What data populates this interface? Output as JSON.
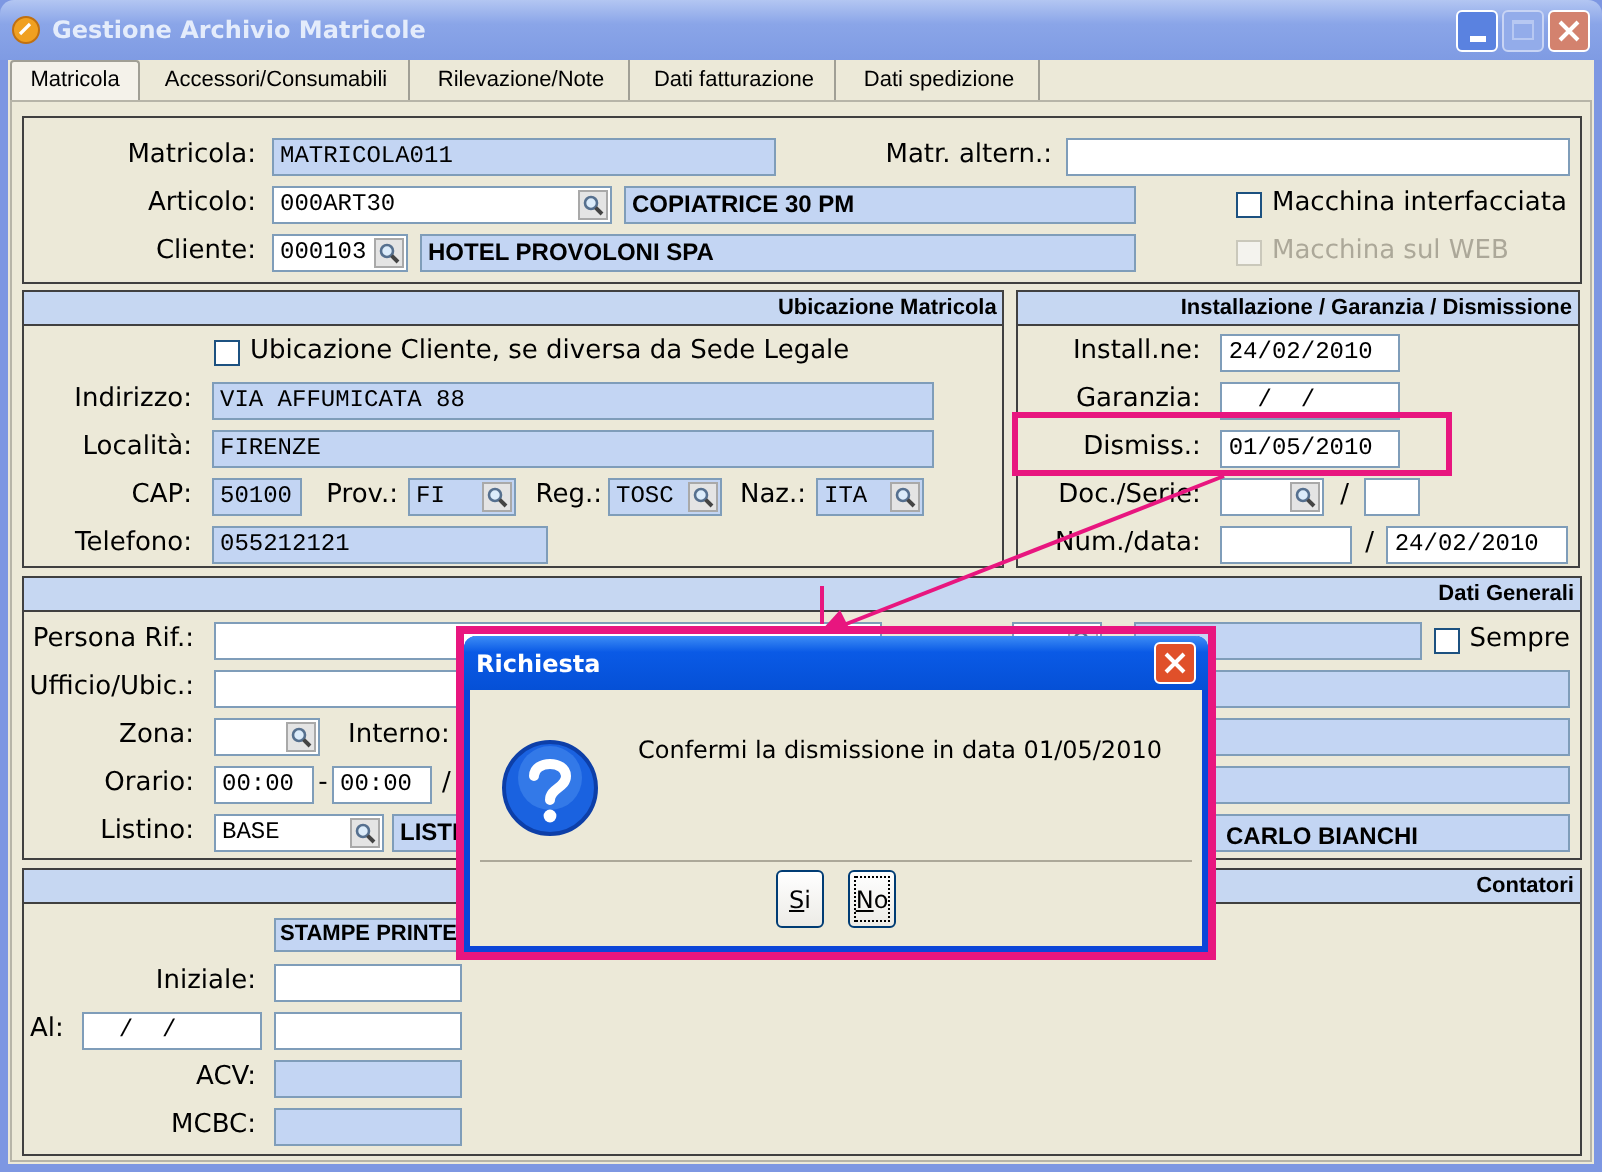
{
  "window": {
    "title": "Gestione Archivio Matricole"
  },
  "tabs": [
    {
      "label": "Matricola",
      "selected": true
    },
    {
      "label": "Accessori/Consumabili",
      "selected": false
    },
    {
      "label": "Rilevazione/Note",
      "selected": false
    },
    {
      "label": "Dati fatturazione",
      "selected": false
    },
    {
      "label": "Dati spedizione",
      "selected": false
    }
  ],
  "matricola": {
    "label": "Matricola:",
    "value": "MATRICOLA011"
  },
  "matr_altern": {
    "label": "Matr. altern.:"
  },
  "articolo": {
    "label": "Articolo:",
    "code": "000ART30",
    "description": "COPIATRICE 30 PM"
  },
  "cliente": {
    "label": "Cliente:",
    "code": "000103",
    "description": "HOTEL PROVOLONI SPA"
  },
  "options": [
    {
      "label": "Macchina interfacciata",
      "checked": false,
      "disabled": false
    },
    {
      "label": "Macchina sul WEB",
      "checked": false,
      "disabled": true
    }
  ],
  "ubicazione": {
    "title": "Ubicazione Matricola",
    "checkbox": {
      "label": "Ubicazione Cliente, se diversa da Sede Legale",
      "checked": false
    },
    "indirizzo": {
      "label": "Indirizzo:",
      "value": "VIA AFFUMICATA 88"
    },
    "localita": {
      "label": "Località:",
      "value": "FIRENZE"
    },
    "cap": {
      "label": "CAP:",
      "value": "50100"
    },
    "prov": {
      "label": "Prov.:",
      "value": "FI"
    },
    "reg": {
      "label": "Reg.:",
      "value": "TOSC"
    },
    "naz": {
      "label": "Naz.:",
      "value": "ITA"
    },
    "telefono": {
      "label": "Telefono:",
      "value": "055212121"
    }
  },
  "installazione": {
    "title": "Installazione / Garanzia / Dismissione",
    "install": {
      "label": "Install.ne:",
      "value": "24/02/2010"
    },
    "garanzia": {
      "label": "Garanzia:",
      "value": "  /  /"
    },
    "dismiss": {
      "label": "Dismiss.:",
      "value": "01/05/2010"
    },
    "doc_serie": {
      "label": "Doc./Serie:",
      "separator": "/"
    },
    "num_data": {
      "label": "Num./data:",
      "separator": "/",
      "date": "24/02/2010"
    }
  },
  "dati_generali": {
    "title": "Dati Generali",
    "persona": {
      "label": "Persona Rif.:"
    },
    "sempre": {
      "label": "Sempre",
      "checked": false
    },
    "ufficio": {
      "label": "Ufficio/Ubic.:"
    },
    "zona": {
      "label": "Zona:"
    },
    "interno": {
      "label": "Interno:"
    },
    "orario": {
      "label": "Orario:",
      "from": "00:00",
      "dash": "-",
      "to": "00:00",
      "slash": "/"
    },
    "listino": {
      "label": "Listino:",
      "code": "BASE",
      "description_start": "LISTI",
      "description_end": "CARLO BIANCHI"
    }
  },
  "contatori": {
    "title": "Contatori",
    "column": "STAMPE PRINTE",
    "iniziale": {
      "label": "Iniziale:"
    },
    "al": {
      "label": "Al:",
      "date": "  /  /"
    },
    "acv": {
      "label": "ACV:"
    },
    "mcbc": {
      "label": "MCBC:"
    }
  },
  "dialog": {
    "title": "Richiesta",
    "message": "Confermi la dismissione in data 01/05/2010",
    "buttons": [
      {
        "label": "Si",
        "focused": false
      },
      {
        "label": "No",
        "focused": true
      }
    ]
  }
}
